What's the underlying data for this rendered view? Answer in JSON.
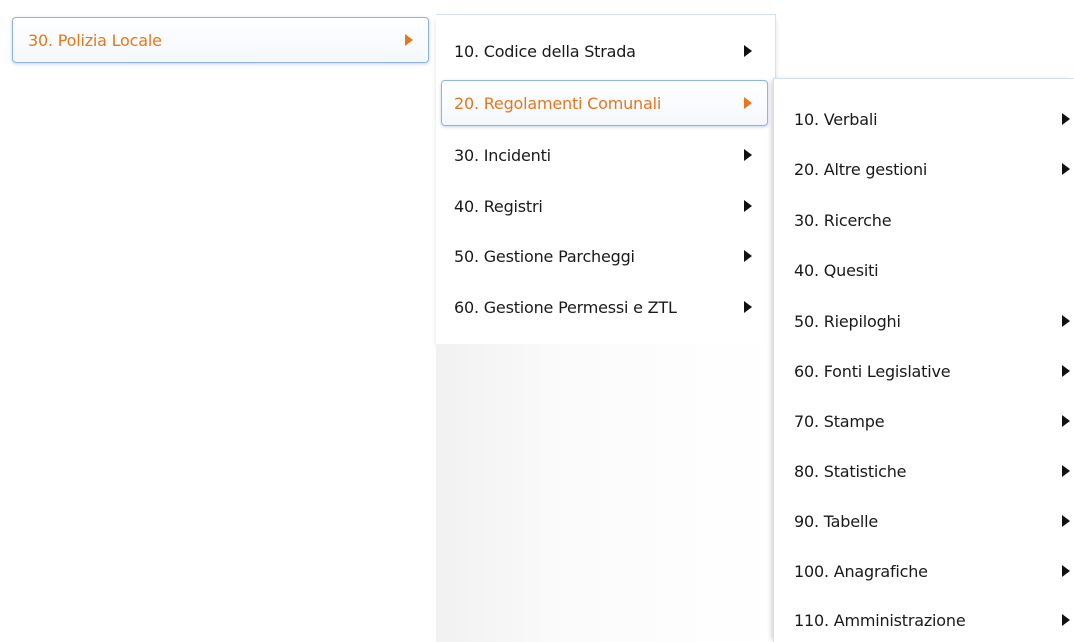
{
  "menu": {
    "level1": {
      "label": "30. Polizia Locale"
    },
    "level2": {
      "items": [
        {
          "label": "10. Codice della Strada",
          "submenu": true
        },
        {
          "label": "20. Regolamenti Comunali",
          "submenu": true
        },
        {
          "label": "30. Incidenti",
          "submenu": true
        },
        {
          "label": "40. Registri",
          "submenu": true
        },
        {
          "label": "50. Gestione Parcheggi",
          "submenu": true
        },
        {
          "label": "60. Gestione Permessi e ZTL",
          "submenu": true
        }
      ]
    },
    "level3": {
      "items": [
        {
          "label": "10. Verbali",
          "submenu": true
        },
        {
          "label": "20. Altre gestioni",
          "submenu": true
        },
        {
          "label": "30. Ricerche",
          "submenu": false
        },
        {
          "label": "40. Quesiti",
          "submenu": false
        },
        {
          "label": "50. Riepiloghi",
          "submenu": true
        },
        {
          "label": "60. Fonti Legislative",
          "submenu": true
        },
        {
          "label": "70. Stampe",
          "submenu": true
        },
        {
          "label": "80. Statistiche",
          "submenu": true
        },
        {
          "label": "90. Tabelle",
          "submenu": true
        },
        {
          "label": "100. Anagrafiche",
          "submenu": true
        },
        {
          "label": "110. Amministrazione",
          "submenu": true
        }
      ]
    }
  },
  "colors": {
    "active_text": "#e8761f",
    "active_border": "#8db4e2",
    "text": "#1a1a1a"
  }
}
